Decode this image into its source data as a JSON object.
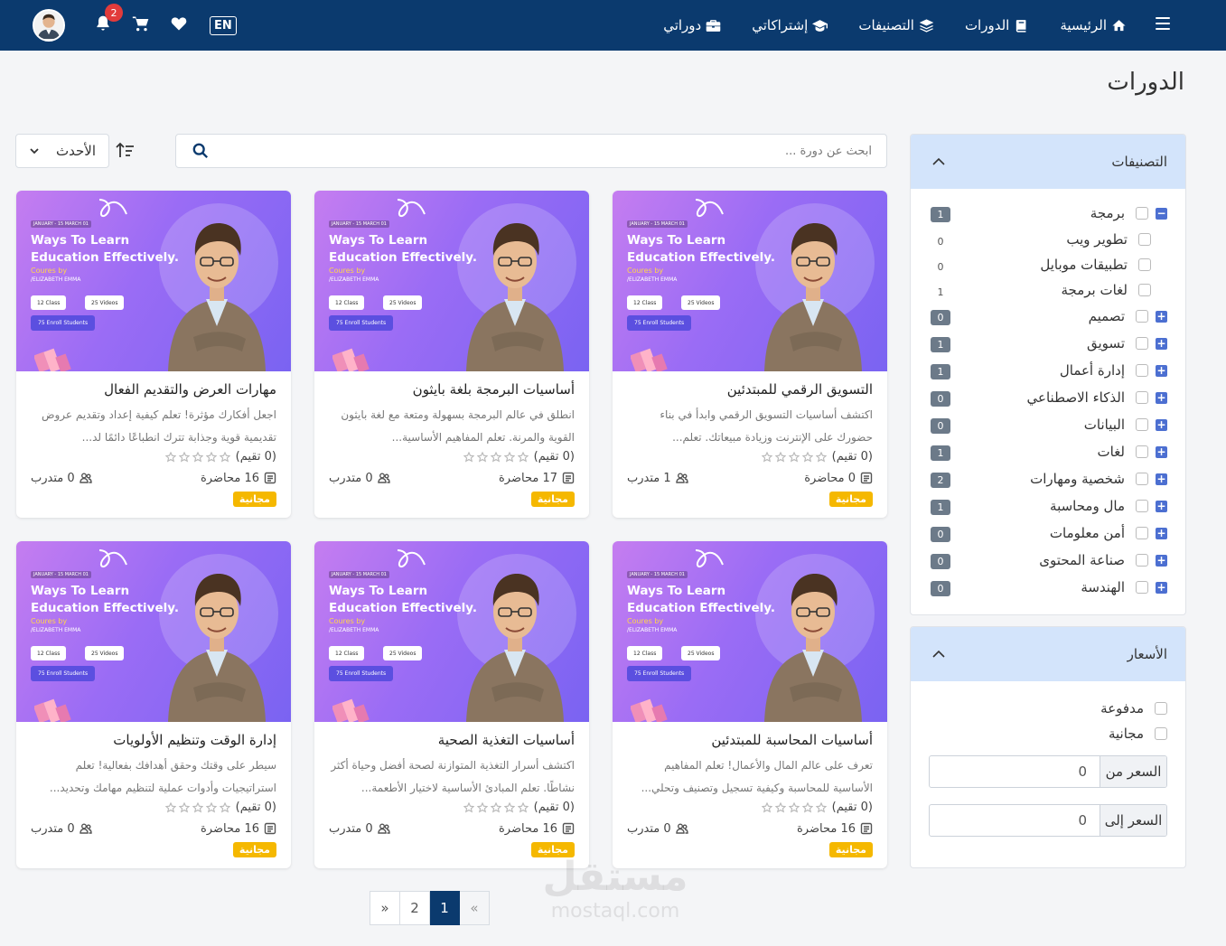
{
  "nav": {
    "links": [
      {
        "label": "الرئيسية",
        "icon": "home-icon"
      },
      {
        "label": "الدورات",
        "icon": "book-icon"
      },
      {
        "label": "التصنيفات",
        "icon": "layers-icon"
      },
      {
        "label": "إشتراكاتي",
        "icon": "graduation-cap-icon"
      },
      {
        "label": "دوراتي",
        "icon": "briefcase-icon"
      }
    ],
    "notification_count": "2",
    "language_button": "EN"
  },
  "page_title": "الدورات",
  "search": {
    "placeholder": "ابحث عن دورة ..."
  },
  "sort": {
    "selected": "الأحدث"
  },
  "categories": {
    "title": "التصنيفات",
    "items": [
      {
        "label": "برمجة",
        "count": "1",
        "expanded": true,
        "sub": false
      },
      {
        "label": "تطوير ويب",
        "count": "0",
        "sub": true
      },
      {
        "label": "تطبيقات موبايل",
        "count": "0",
        "sub": true
      },
      {
        "label": "لغات برمجة",
        "count": "1",
        "sub": true
      },
      {
        "label": "تصميم",
        "count": "0",
        "sub": false
      },
      {
        "label": "تسويق",
        "count": "1",
        "sub": false
      },
      {
        "label": "إدارة أعمال",
        "count": "1",
        "sub": false
      },
      {
        "label": "الذكاء الاصطناعي",
        "count": "0",
        "sub": false
      },
      {
        "label": "البيانات",
        "count": "0",
        "sub": false
      },
      {
        "label": "لغات",
        "count": "1",
        "sub": false
      },
      {
        "label": "شخصية ومهارات",
        "count": "2",
        "sub": false
      },
      {
        "label": "مال ومحاسبة",
        "count": "1",
        "sub": false
      },
      {
        "label": "أمن معلومات",
        "count": "0",
        "sub": false
      },
      {
        "label": "صناعة المحتوى",
        "count": "0",
        "sub": false
      },
      {
        "label": "الهندسة",
        "count": "0",
        "sub": false
      }
    ]
  },
  "prices": {
    "title": "الأسعار",
    "options": [
      "مدفوعة",
      "مجانية"
    ],
    "from_label": "السعر من",
    "from_value": "0",
    "to_label": "السعر إلى",
    "to_value": "0"
  },
  "card_image": {
    "ribbon": "01 JANUARY - 15 MARCH",
    "title_line1": "Ways To Learn",
    "title_line2": "Education Effectively.",
    "coures_by": "Coures by",
    "author": "/ELIZABETH EMMA",
    "pill_class": "12 Class",
    "pill_videos": "25 Videos",
    "pill_students": "75 Enroll Students"
  },
  "courses": [
    {
      "title": "التسويق الرقمي للمبتدئين",
      "desc": "اكتشف أساسيات التسويق الرقمي وابدأ في بناء حضورك على الإنترنت وزيادة مبيعاتك. تعلم...",
      "rating": "(0 تقيم)",
      "lectures": "0 محاضرة",
      "students": "1 متدرب",
      "badge": "مجانية"
    },
    {
      "title": "أساسيات البرمجة بلغة بايثون",
      "desc": "انطلق في عالم البرمجة بسهولة ومتعة مع لغة بايثون القوية والمرنة. تعلم المفاهيم الأساسية...",
      "rating": "(0 تقيم)",
      "lectures": "17 محاضرة",
      "students": "0 متدرب",
      "badge": "مجانية"
    },
    {
      "title": "مهارات العرض والتقديم الفعال",
      "desc": "اجعل أفكارك مؤثرة! تعلم كيفية إعداد وتقديم عروض تقديمية قوية وجذابة تترك انطباعًا دائمًا لد...",
      "rating": "(0 تقيم)",
      "lectures": "16 محاضرة",
      "students": "0 متدرب",
      "badge": "مجانية"
    },
    {
      "title": "أساسيات المحاسبة للمبتدئين",
      "desc": "تعرف على عالم المال والأعمال! تعلم المفاهيم الأساسية للمحاسبة وكيفية تسجيل وتصنيف وتحلي...",
      "rating": "(0 تقيم)",
      "lectures": "16 محاضرة",
      "students": "0 متدرب",
      "badge": "مجانية"
    },
    {
      "title": "أساسيات التغذية الصحية",
      "desc": "اكتشف أسرار التغذية المتوازنة لصحة أفضل وحياة أكثر نشاطًا. تعلم المبادئ الأساسية لاختيار الأطعمة...",
      "rating": "(0 تقيم)",
      "lectures": "16 محاضرة",
      "students": "0 متدرب",
      "badge": "مجانية"
    },
    {
      "title": "إدارة الوقت وتنظيم الأولويات",
      "desc": "سيطر على وقتك وحقق أهدافك بفعالية! تعلم استراتيجيات وأدوات عملية لتنظيم مهامك وتحديد...",
      "rating": "(0 تقيم)",
      "lectures": "16 محاضرة",
      "students": "0 متدرب",
      "badge": "مجانية"
    }
  ],
  "pagination": {
    "prev": "«",
    "pages": [
      "1",
      "2"
    ],
    "active": "1",
    "next": "»"
  },
  "watermark": {
    "arabic": "مستقل",
    "latin": "mostaql.com"
  }
}
